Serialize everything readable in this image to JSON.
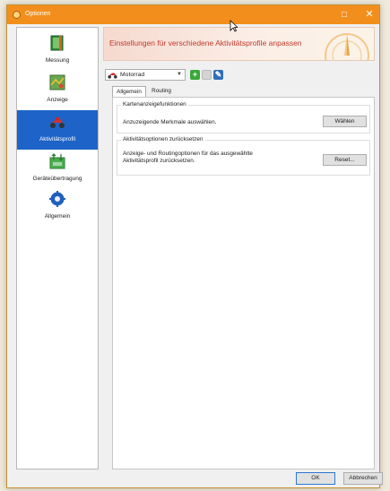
{
  "window": {
    "title": "Optionen"
  },
  "sidebar": {
    "items": [
      {
        "label": "Messung",
        "icon": "map-ruler-icon"
      },
      {
        "label": "Anzeige",
        "icon": "display-map-icon"
      },
      {
        "label": "Aktivitätsprofil",
        "icon": "motorcycle-icon",
        "active": true
      },
      {
        "label": "Geräteübertragung",
        "icon": "device-transfer-icon"
      },
      {
        "label": "Allgemein",
        "icon": "gear-icon"
      }
    ]
  },
  "banner": {
    "text": "Einstellungen für verschiedene Aktivitätsprofile anpassen"
  },
  "profile": {
    "selected": "Motorrad"
  },
  "tabs": {
    "allgemein": "Allgemein",
    "routing": "Routing"
  },
  "groups": {
    "map": {
      "title": "Kartenanzeigefunktionen",
      "text": "Anzuzeigende Merkmale auswählen.",
      "button": "Wählen"
    },
    "reset": {
      "title": "Aktivitätsoptionen zurücksetzen",
      "text_line1": "Anzeige- und Routingoptionen für das ausgewählte",
      "text_line2": "Aktivitätsprofil zurücksetzen.",
      "button": "Reset..."
    }
  },
  "footer": {
    "ok": "OK",
    "cancel": "Abbrechen"
  },
  "colors": {
    "titlebar": "#f28f1c",
    "active": "#1e64c8",
    "banner_text": "#c0392b"
  }
}
